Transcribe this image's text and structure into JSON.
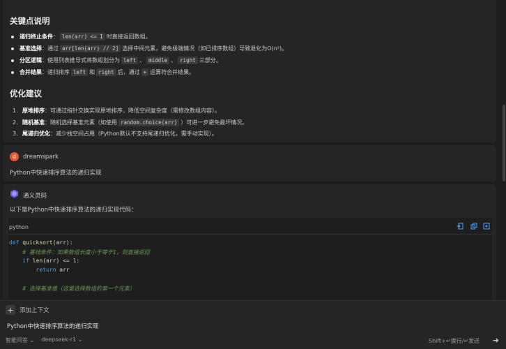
{
  "ai_answer_1": {
    "heading_keypoints": "关键点说明",
    "keypoints": [
      {
        "title": "递归终止条件",
        "pre": "",
        "code1": "len(arr) <= 1",
        "mid": " 时直接返回数组。",
        "code2": "",
        "mid2": "",
        "code3": "",
        "tail": ""
      },
      {
        "title": "基准选择",
        "pre": "通过 ",
        "code1": "arr[len(arr) // 2]",
        "mid": " 选择中间元素，避免极端情况（如已排序数组）导致退化为O(n²)。",
        "code2": "",
        "mid2": "",
        "code3": "",
        "tail": ""
      },
      {
        "title": "分区逻辑",
        "pre": "使用列表推导式将数组划分为 ",
        "code1": "left",
        "mid": "、",
        "code2": "middle",
        "mid2": "、",
        "code3": "right",
        "tail": " 三部分。"
      },
      {
        "title": "合并结果",
        "pre": "递归排序 ",
        "code1": "left",
        "mid": " 和 ",
        "code2": "right",
        "mid2": " 后，通过 ",
        "code3": "+",
        "tail": " 运算符合并结果。"
      }
    ],
    "heading_opt": "优化建议",
    "optimizations": [
      {
        "num": "1.",
        "title": "原地排序",
        "pre": "可通过指针交换实现原地排序，降低空间复杂度（需修改数组内容）。",
        "code": "",
        "tail": ""
      },
      {
        "num": "2.",
        "title": "随机基准",
        "pre": "随机选择基准元素（如使用 ",
        "code": "random.choice(arr)",
        "tail": "）可进一步避免最坏情况。"
      },
      {
        "num": "3.",
        "title": "尾递归优化",
        "pre": "减少栈空间占用（Python默认不支持尾递归优化，需手动实现）。",
        "code": "",
        "tail": ""
      }
    ]
  },
  "user_message": {
    "avatar_letter": "d",
    "username": "dreamspark",
    "text": "Python中快速排序算法的递归实现"
  },
  "ai_answer_2": {
    "name": "通义灵码",
    "intro": "以下是Python中快速排序算法的递归实现代码：",
    "code_lang": "python",
    "code_lines": [
      "def quicksort(arr):",
      "    # 基线条件：如果数组长度小于等于1，则直接返回",
      "    if len(arr) <= 1:",
      "        return arr",
      "",
      "    # 选择基准值（这里选择数组的第一个元素）"
    ]
  },
  "composer": {
    "add_context": "添加上下文",
    "input_text": "Python中快速排序算法的递归实现",
    "mode": "智能问答",
    "model": "deepseek-r1",
    "hint": "Shift+↵换行/↵发送"
  },
  "colors": {
    "background": "#1e1e1e",
    "card": "#252526",
    "avatar_user": "#e05a3a",
    "keyword": "#569cd6",
    "function": "#dcdcaa",
    "comment": "#6a9955"
  }
}
